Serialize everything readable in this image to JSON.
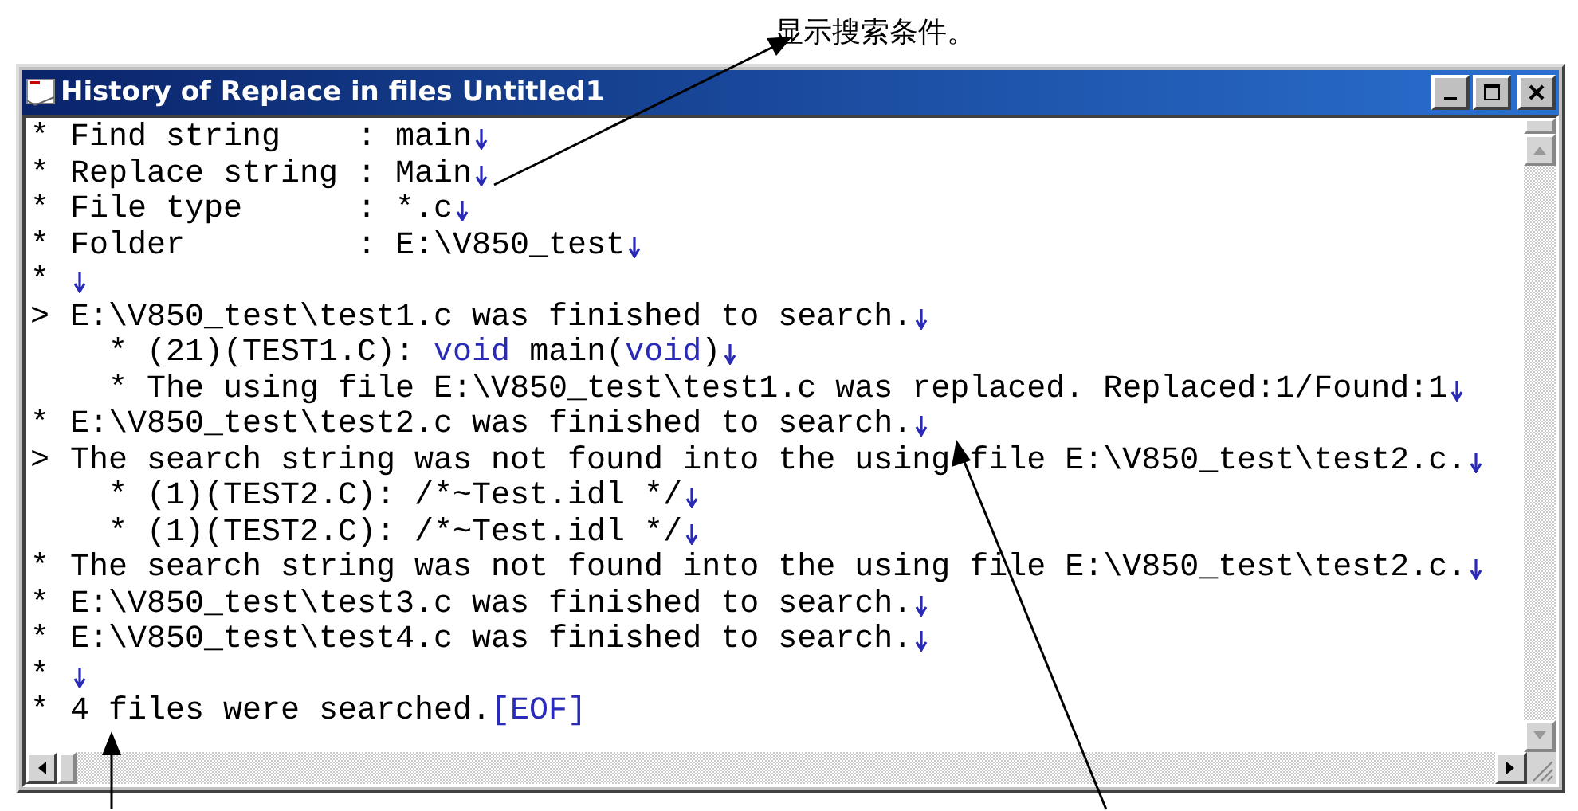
{
  "annotations": [
    {
      "text": "显示搜索条件。"
    }
  ],
  "window": {
    "title": "History of Replace in files Untitled1"
  },
  "log": [
    {
      "kind": "entry",
      "gutter": "*",
      "parts": [
        {
          "kind": "plain",
          "text": "Find string    : main"
        }
      ],
      "eol": true
    },
    {
      "kind": "entry",
      "gutter": "*",
      "parts": [
        {
          "kind": "plain",
          "text": "Replace string : Main"
        }
      ],
      "eol": true
    },
    {
      "kind": "entry",
      "gutter": "*",
      "parts": [
        {
          "kind": "plain",
          "text": "File type      : *.c"
        }
      ],
      "eol": true
    },
    {
      "kind": "entry",
      "gutter": "*",
      "parts": [
        {
          "kind": "plain",
          "text": "Folder         : E:\\V850_test"
        }
      ],
      "eol": true
    },
    {
      "kind": "entry",
      "gutter": "*",
      "eol": true
    },
    {
      "kind": "entry",
      "gutter": ">",
      "parts": [
        {
          "kind": "plain",
          "text": "E:\\V850_test\\test1.c was finished to search."
        }
      ],
      "eol": true
    },
    {
      "kind": "detail",
      "parts": [
        {
          "kind": "plain",
          "text": "* (21)(TEST1.C): "
        },
        {
          "kind": "keyword",
          "text": "void"
        },
        {
          "kind": "plain",
          "text": " main("
        },
        {
          "kind": "keyword",
          "text": "void"
        },
        {
          "kind": "plain",
          "text": ")"
        }
      ],
      "eol": true
    },
    {
      "kind": "detail",
      "parts": [
        {
          "kind": "plain",
          "text": "* The using file E:\\V850_test\\test1.c was replaced. Replaced:1/Found:1"
        }
      ],
      "eol": true
    },
    {
      "kind": "entry",
      "gutter": "*",
      "parts": [
        {
          "kind": "plain",
          "text": "E:\\V850_test\\test2.c was finished to search."
        }
      ],
      "eol": true
    },
    {
      "kind": "entry",
      "gutter": ">",
      "parts": [
        {
          "kind": "plain",
          "text": "The search string was not found into the using file E:\\V850_test\\test2.c."
        }
      ],
      "eol": true
    },
    {
      "kind": "detail",
      "parts": [
        {
          "kind": "plain",
          "text": "* (1)(TEST2.C): /*~Test.idl */"
        }
      ],
      "eol": true
    },
    {
      "kind": "detail",
      "parts": [
        {
          "kind": "plain",
          "text": "* (1)(TEST2.C): /*~Test.idl */"
        }
      ],
      "eol": true
    },
    {
      "kind": "entry",
      "gutter": "*",
      "parts": [
        {
          "kind": "plain",
          "text": "The search string was not found into the using file E:\\V850_test\\test2.c."
        }
      ],
      "eol": true
    },
    {
      "kind": "entry",
      "gutter": "*",
      "parts": [
        {
          "kind": "plain",
          "text": "E:\\V850_test\\test3.c was finished to search."
        }
      ],
      "eol": true
    },
    {
      "kind": "entry",
      "gutter": "*",
      "parts": [
        {
          "kind": "plain",
          "text": "E:\\V850_test\\test4.c was finished to search."
        }
      ],
      "eol": true
    },
    {
      "kind": "entry",
      "gutter": "*",
      "eol": true
    },
    {
      "kind": "entry",
      "gutter": "*",
      "parts": [
        {
          "kind": "plain",
          "text": "4 files were searched."
        },
        {
          "kind": "keyword",
          "text": "[EOF]"
        }
      ],
      "eol": false
    }
  ]
}
